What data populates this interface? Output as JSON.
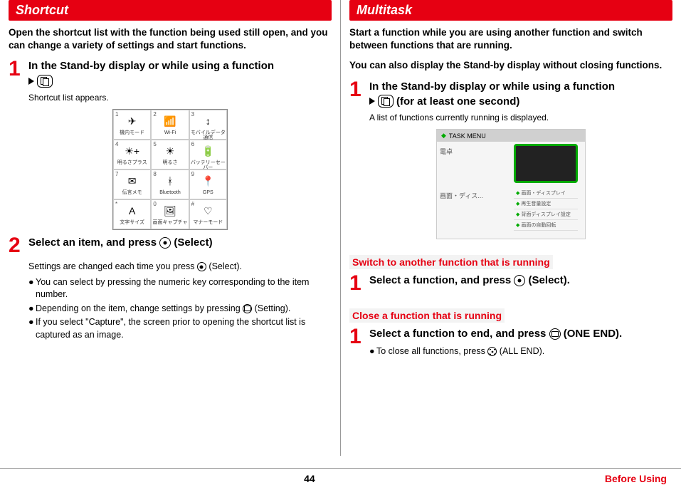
{
  "left": {
    "header": "Shortcut",
    "intro": "Open the shortcut list with the function being used still open, and you can change a variety of settings and start functions.",
    "step1": {
      "title": "In the Stand-by display or while using a function",
      "sub": "Shortcut list appears."
    },
    "grid": [
      [
        {
          "num": "1",
          "lbl": "機内モード",
          "ico": "✈"
        },
        {
          "num": "2",
          "lbl": "Wi-Fi",
          "ico": "📶"
        },
        {
          "num": "3",
          "lbl": "モバイルデータ通信",
          "ico": "↕"
        }
      ],
      [
        {
          "num": "4",
          "lbl": "明るさプラス",
          "ico": "☀+"
        },
        {
          "num": "5",
          "lbl": "明るさ",
          "ico": "☀"
        },
        {
          "num": "6",
          "lbl": "バッテリーセーバー",
          "ico": "🔋"
        }
      ],
      [
        {
          "num": "7",
          "lbl": "伝言メモ",
          "ico": "✉"
        },
        {
          "num": "8",
          "lbl": "Bluetooth",
          "ico": "ᚼ"
        },
        {
          "num": "9",
          "lbl": "GPS",
          "ico": "📍"
        }
      ],
      [
        {
          "num": "*",
          "lbl": "文字サイズ",
          "ico": "A"
        },
        {
          "num": "0",
          "lbl": "画面キャプチャ",
          "ico": "🖼"
        },
        {
          "num": "#",
          "lbl": "マナーモード",
          "ico": "♡"
        }
      ]
    ],
    "step2": {
      "title": "Select an item, and press ",
      "title_suffix": " (Select)",
      "sub": "Settings are changed each time you press ",
      "sub_suffix": " (Select).",
      "b1_a": "You can select by pressing the numeric key corresponding to the item number.",
      "b2_a": "Depending on the item, change settings by pressing ",
      "b2_b": " (Setting).",
      "b3_a": "If you select \"Capture\", the screen prior to opening the shortcut list is captured as an image."
    }
  },
  "right": {
    "header": "Multitask",
    "intro1": "Start a function while you are using another function and switch between functions that are running.",
    "intro2": "You can also display the Stand-by display without closing functions.",
    "step1": {
      "title": "In the Stand-by display or while using a function",
      "line2_suffix": " (for at least one second)",
      "sub": "A list of functions currently running is displayed."
    },
    "task": {
      "title": "TASK MENU",
      "left1": "電卓",
      "left2": "画面・ディス...",
      "list": [
        "画面・ディスプレイ",
        "再生音量設定",
        "背面ディスプレイ設定",
        "画面の自動回転"
      ]
    },
    "sub1": {
      "header": "Switch to another function that is running",
      "step": "Select a function, and press ",
      "step_suffix": " (Select)."
    },
    "sub2": {
      "header": "Close a function that is running",
      "step": "Select a function to end, and press ",
      "step_suffix": " (ONE END).",
      "b1_a": "To close all functions, press ",
      "b1_b": " (ALL END)."
    }
  },
  "footer": {
    "page": "44",
    "section": "Before Using"
  }
}
